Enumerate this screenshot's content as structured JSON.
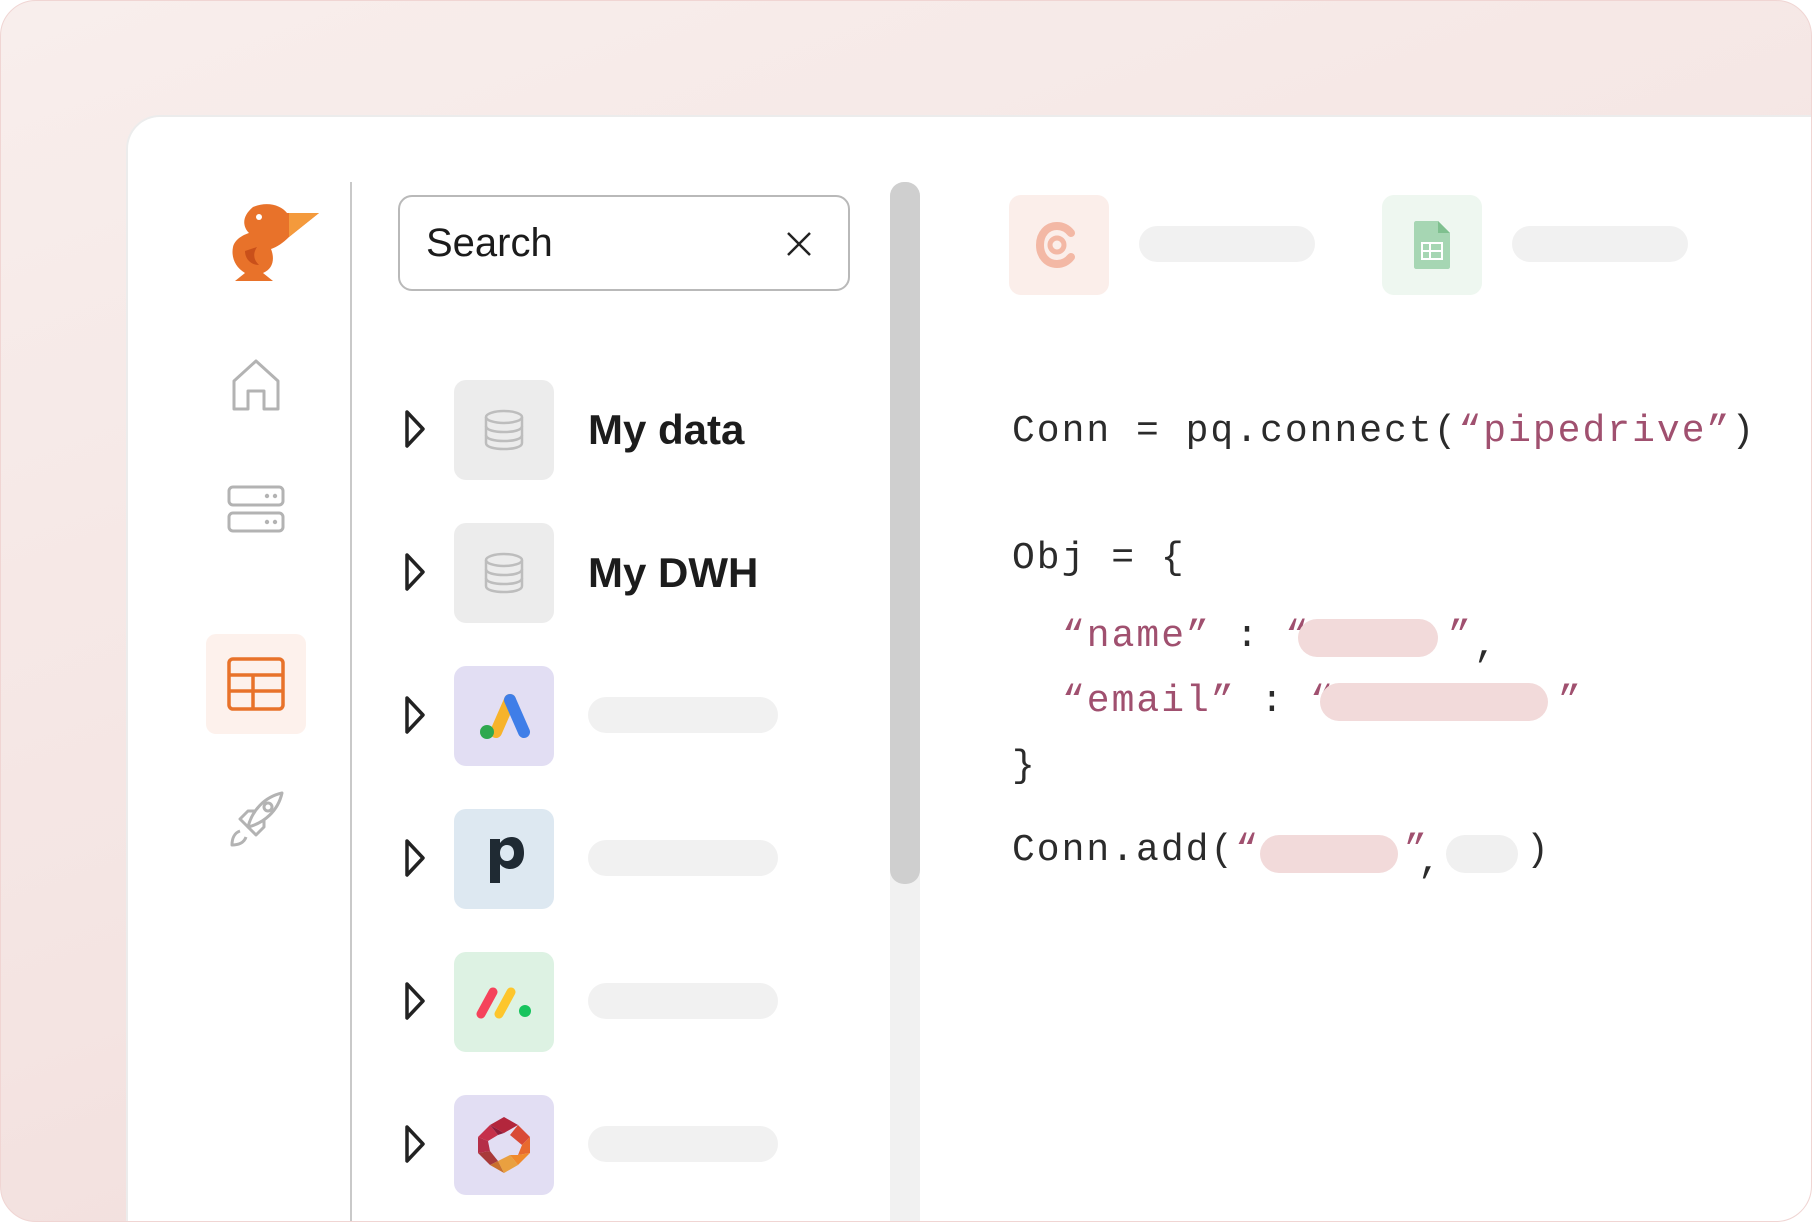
{
  "search": {
    "value": "Search"
  },
  "sidebar": {
    "items": [
      {
        "icon": "home-icon"
      },
      {
        "icon": "server-icon"
      },
      {
        "icon": "table-icon",
        "active": true
      },
      {
        "icon": "rocket-icon"
      }
    ]
  },
  "tree": {
    "items": [
      {
        "label": "My data",
        "icon": "database-icon"
      },
      {
        "label": "My DWH",
        "icon": "database-icon"
      },
      {
        "label": "",
        "icon": "google-ads-icon"
      },
      {
        "label": "",
        "icon": "pipedrive-icon"
      },
      {
        "label": "",
        "icon": "monday-icon"
      },
      {
        "label": "",
        "icon": "hexagon-logo-icon"
      }
    ]
  },
  "connectors": [
    {
      "icon": "c-logo-icon"
    },
    {
      "icon": "google-sheets-icon"
    }
  ],
  "code": {
    "line1_prefix": "Conn = pq.connect(",
    "line1_string": "“pipedrive”",
    "line1_suffix": ")",
    "line2": "Obj = {",
    "line3_key": "“name”",
    "line3_sep": " : ",
    "line3_open": "“",
    "line3_close": "”",
    "line3_comma": ",",
    "line4_key": "“email”",
    "line4_sep": " : ",
    "line4_open": "“",
    "line4_close": "”",
    "line5": "}",
    "line6_prefix": "Conn.add(",
    "line6_open": "“",
    "line6_close": "”",
    "line6_comma": ",",
    "line6_suffix": ")"
  },
  "colors": {
    "accent": "#e8722a",
    "string": "#a0506f",
    "redacted": "#f2dada"
  }
}
